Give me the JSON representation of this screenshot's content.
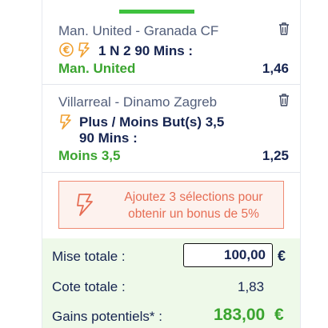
{
  "bets": [
    {
      "match": "Man. United - Granada CF",
      "market": "1 N 2 90 Mins :",
      "selection": "Man. United",
      "odd": "1,46",
      "icons": [
        "euro-cashout-icon",
        "lightning-icon"
      ]
    },
    {
      "match": "Villarreal - Dinamo Zagreb",
      "market_line1": "Plus / Moins But(s) 3,5",
      "market_line2": "90 Mins :",
      "selection": "Moins 3,5",
      "odd": "1,25",
      "icons": [
        "lightning-icon"
      ]
    }
  ],
  "promo": {
    "text": "Ajoutez 3 sélections pour obtenir un bonus de 5%",
    "icon": "lightning-icon"
  },
  "summary": {
    "stake_label": "Mise totale :",
    "stake_value": "100,00",
    "stake_currency": "€",
    "odds_label": "Cote totale :",
    "odds_value": "1,83",
    "gains_label": "Gains potentiels* :",
    "gains_value": "183,00",
    "gains_currency": "€"
  },
  "colors": {
    "accent_green": "#3ec23e",
    "selection_green": "#3aa42f",
    "promo_orange": "#e66d54",
    "icon_orange": "#f0a030",
    "navy": "#162450"
  }
}
